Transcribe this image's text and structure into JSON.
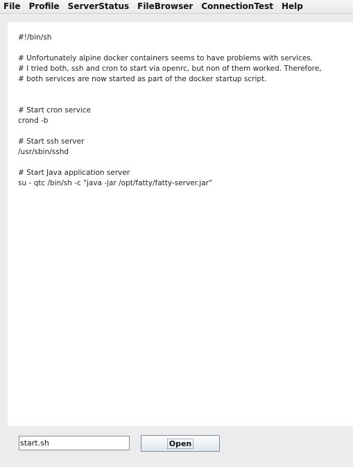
{
  "menubar": {
    "items": [
      "File",
      "Profile",
      "ServerStatus",
      "FileBrowser",
      "ConnectionTest",
      "Help"
    ]
  },
  "editor": {
    "content": "#!/bin/sh\n\n# Unfortunately alpine docker containers seems to have problems with services.\n# I tried both, ssh and cron to start via openrc, but non of them worked. Therefore,\n# both services are now started as part of the docker startup script.\n\n\n# Start cron service\ncrond -b\n\n# Start ssh server\n/usr/sbin/sshd\n\n# Start Java application server\nsu - qtc /bin/sh -c \"java -jar /opt/fatty/fatty-server.jar\""
  },
  "footer": {
    "filename_value": "start.sh",
    "open_label": "Open"
  }
}
